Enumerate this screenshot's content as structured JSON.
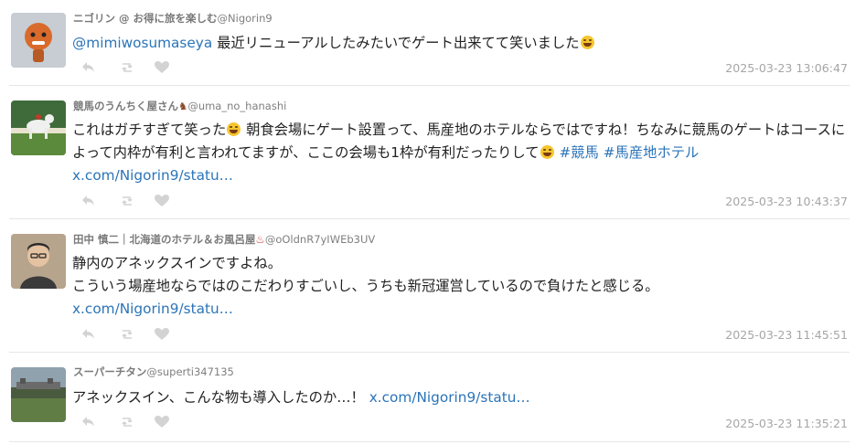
{
  "tweets": [
    {
      "name": "ニゴリン @ お得に旅を楽しむ",
      "handle": "@Nigorin9",
      "segments_plain": [
        {
          "type": "mention",
          "text": "@mimiwosumaseya"
        },
        {
          "type": "text",
          "text": " 最近リニューアルしたみたいでゲート出来てて笑いました"
        }
      ],
      "time": "2025-03-23 13:06:47"
    },
    {
      "name": "競馬のうんちく屋さん",
      "handle": "@uma_no_hanashi",
      "text_1": "これはガチすぎて笑った",
      "text_2": " 朝食会場にゲート設置って、馬産地のホテルならではですね！ちなみに競馬のゲートはコースによって内枠が有利と言われてますが、ここの会場も1枠が有利だったりして",
      "tag_1": "#競馬",
      "tag_2": "#馬産地ホテル",
      "link": "x.com/Nigorin9/statu…",
      "time": "2025-03-23 10:43:37"
    },
    {
      "name": "田中 慎二｜北海道のホテル＆お風呂屋",
      "handle": "@oOldnR7yIWEb3UV",
      "line_1": "静内のアネックスインですよね。",
      "line_2": "こういう場産地ならではのこだわりすごいし、うちも新冠運営しているので負けたと感じる。",
      "link": "x.com/Nigorin9/statu…",
      "time": "2025-03-23 11:45:51"
    },
    {
      "name": "スーパーチタン",
      "handle": "@superti347135",
      "text": "アネックスイン、こんな物も導入したのか…！ ",
      "link": "x.com/Nigorin9/statu…",
      "time": "2025-03-23 11:35:21"
    }
  ],
  "icons": {
    "reply": "reply-icon",
    "retweet": "retweet-icon",
    "like": "heart-icon",
    "emoji_laugh": "rolling-laughing-emoji",
    "emoji_grin": "grinning-emoji",
    "horse_emoji": "horse-emoji",
    "hot_spring_emoji": "hot-springs-emoji"
  },
  "colors": {
    "link": "#2b74b8",
    "meta": "#a6a6a6",
    "icon": "#d3d3d3"
  }
}
